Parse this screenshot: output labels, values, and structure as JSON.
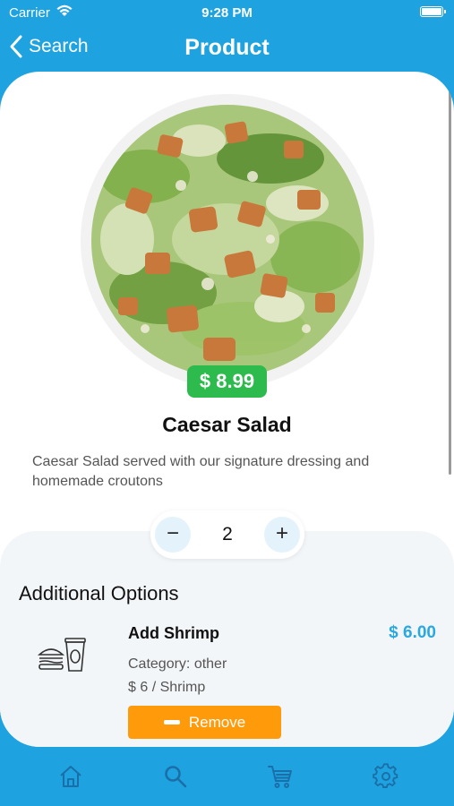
{
  "status": {
    "carrier": "Carrier",
    "time": "9:28 PM"
  },
  "nav": {
    "back_label": "Search",
    "title": "Product"
  },
  "product": {
    "price": "$ 8.99",
    "name": "Caesar Salad",
    "description": "Caesar Salad served with our signature dressing and homemade croutons",
    "quantity": "2"
  },
  "quantity_controls": {
    "minus": "−",
    "plus": "+"
  },
  "options": {
    "title": "Additional Options",
    "items": [
      {
        "name": "Add Shrimp",
        "price": "$ 6.00",
        "category": "Category: other",
        "unit": "$ 6 / Shrimp",
        "button_label": "Remove",
        "icon": "fast-food-icon"
      }
    ]
  },
  "tabbar": {
    "items": [
      "home-icon",
      "search-icon",
      "cart-icon",
      "settings-icon"
    ]
  },
  "colors": {
    "primary": "#1ea3e0",
    "price_badge": "#2dbb4e",
    "remove_button": "#ff9a0b",
    "option_price": "#29a8e1"
  }
}
